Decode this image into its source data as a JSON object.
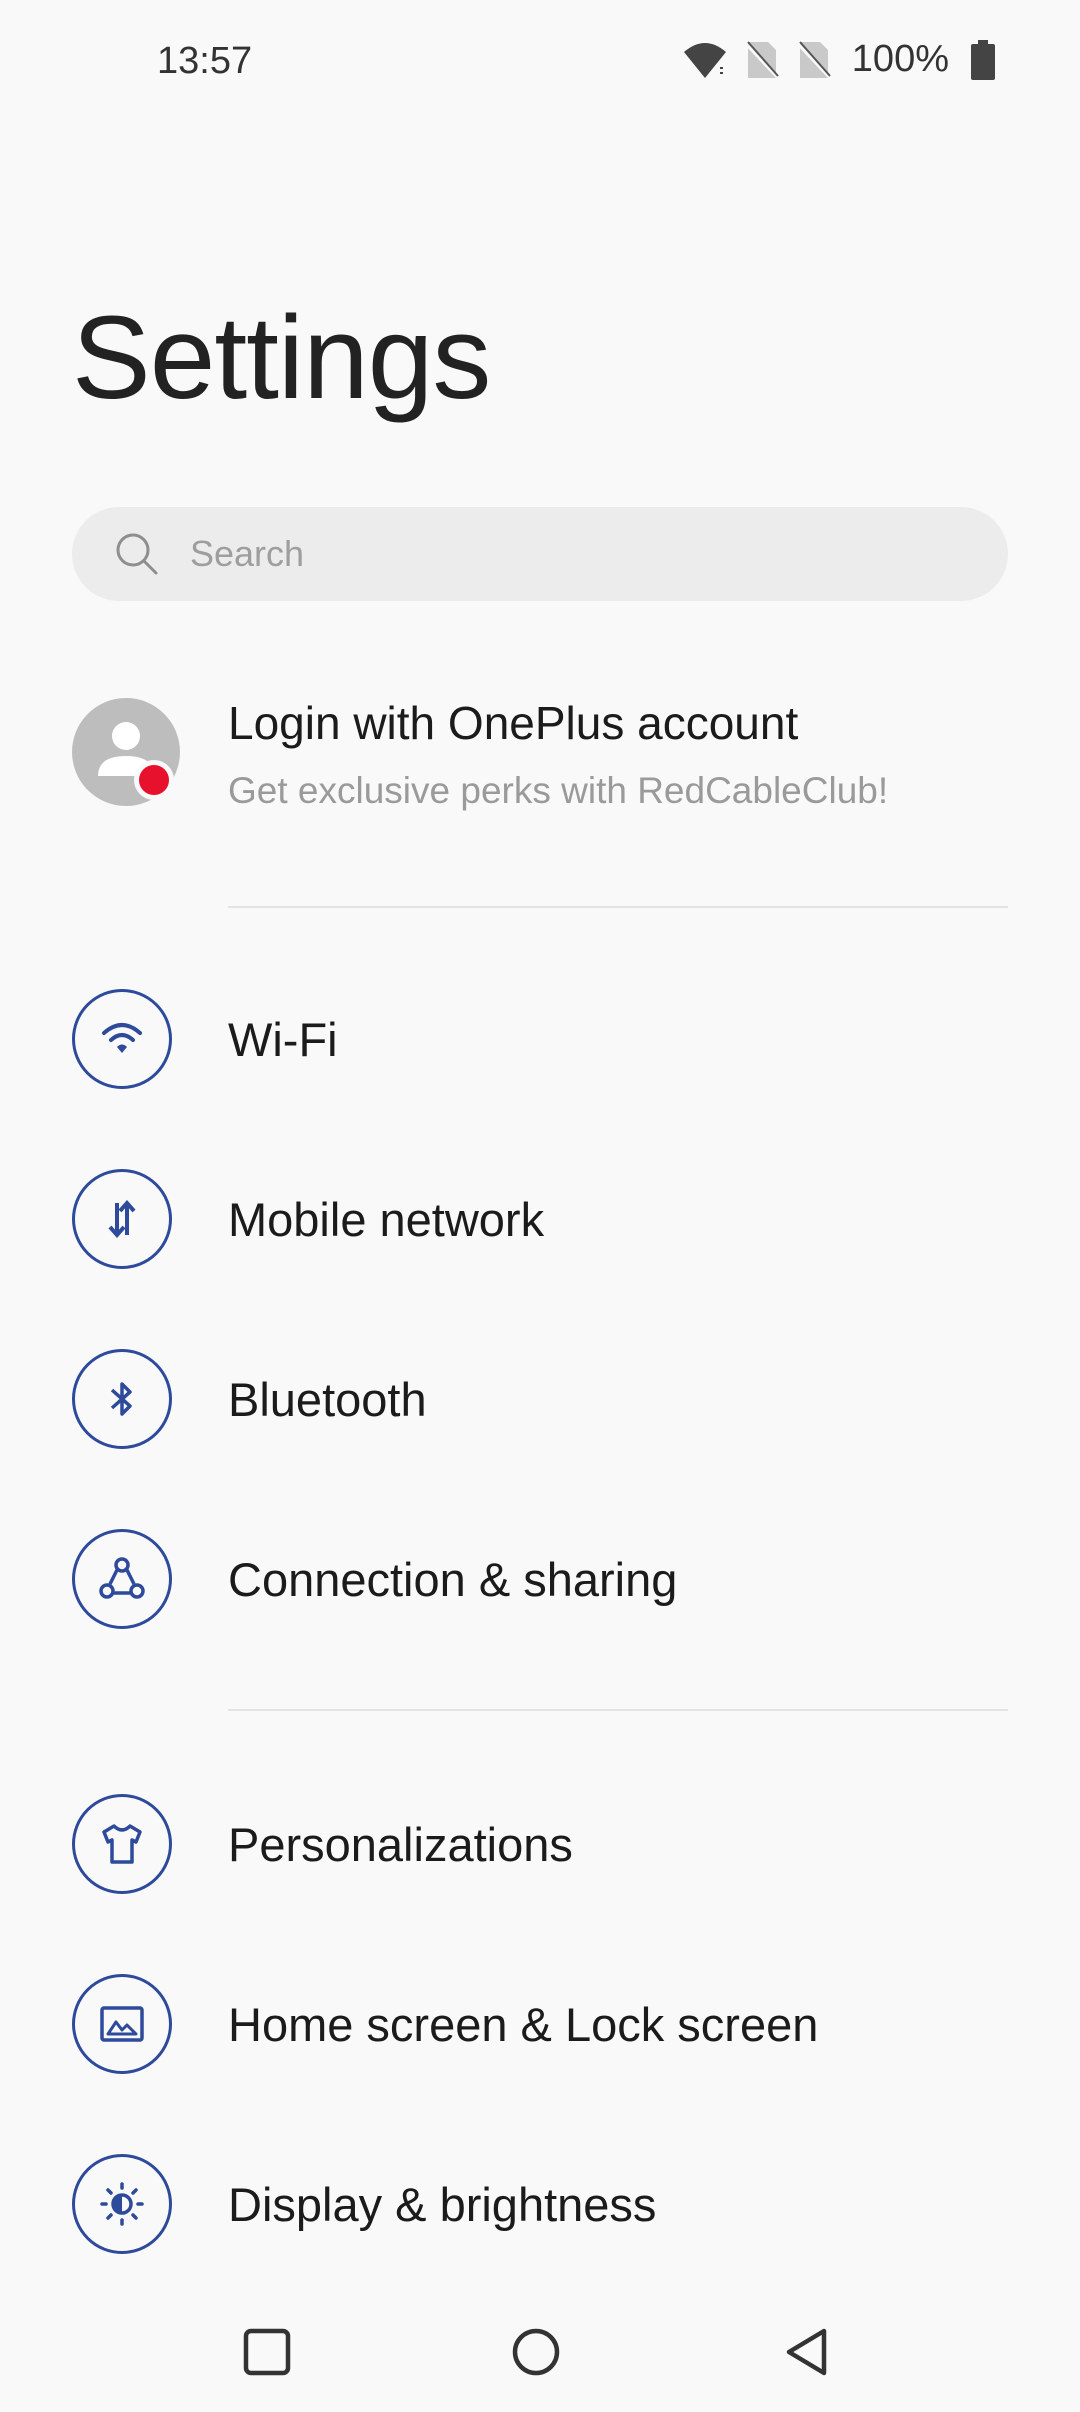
{
  "status_bar": {
    "time": "13:57",
    "battery": "100%",
    "icons": [
      "wifi-icon",
      "no-sim-icon",
      "no-sim-icon",
      "battery-icon"
    ]
  },
  "page": {
    "title": "Settings"
  },
  "search": {
    "placeholder": "Search",
    "value": ""
  },
  "account": {
    "title": "Login with OnePlus account",
    "subtitle": "Get exclusive perks with RedCableClub!",
    "badge_color": "#e8112d"
  },
  "groups": [
    {
      "items": [
        {
          "label": "Wi-Fi",
          "icon": "wifi-icon"
        },
        {
          "label": "Mobile network",
          "icon": "mobile-data-icon"
        },
        {
          "label": "Bluetooth",
          "icon": "bluetooth-icon"
        },
        {
          "label": "Connection & sharing",
          "icon": "connection-sharing-icon"
        }
      ]
    },
    {
      "items": [
        {
          "label": "Personalizations",
          "icon": "tshirt-icon"
        },
        {
          "label": "Home screen & Lock screen",
          "icon": "home-lock-screen-icon"
        },
        {
          "label": "Display & brightness",
          "icon": "brightness-icon"
        }
      ]
    }
  ],
  "colors": {
    "accent": "#2d4a9b",
    "background": "#f9f9f9",
    "search_background": "#ececec"
  },
  "nav_bar": {
    "buttons": [
      "recents-button",
      "home-button",
      "back-button"
    ]
  }
}
